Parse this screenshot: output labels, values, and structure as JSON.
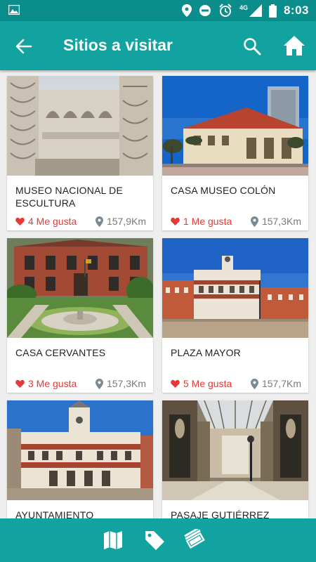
{
  "status": {
    "time": "8:03",
    "network": "4G"
  },
  "appbar": {
    "title": "Sitios a visitar"
  },
  "places": [
    {
      "name": "MUSEO NACIONAL DE ESCULTURA",
      "likes": "4 Me gusta",
      "distance": "157,9Km"
    },
    {
      "name": "CASA MUSEO COLÓN",
      "likes": "1 Me gusta",
      "distance": "157,3Km"
    },
    {
      "name": "CASA CERVANTES",
      "likes": "3 Me gusta",
      "distance": "157,3Km"
    },
    {
      "name": "PLAZA MAYOR",
      "likes": "5 Me gusta",
      "distance": "157,7Km"
    },
    {
      "name": "AYUNTAMIENTO",
      "likes": "",
      "distance": ""
    },
    {
      "name": "PASAJE GUTIÉRREZ",
      "likes": "",
      "distance": ""
    }
  ],
  "colors": {
    "status_bar": "#0a8d8b",
    "app_bar": "#12a3a1",
    "like": "#e53935",
    "distance": "#7a7a7a"
  },
  "icons": {
    "back": "arrow-left-icon",
    "search": "search-icon",
    "home": "home-icon",
    "map": "map-icon",
    "tag": "tag-icon",
    "tickets": "tickets-icon"
  }
}
